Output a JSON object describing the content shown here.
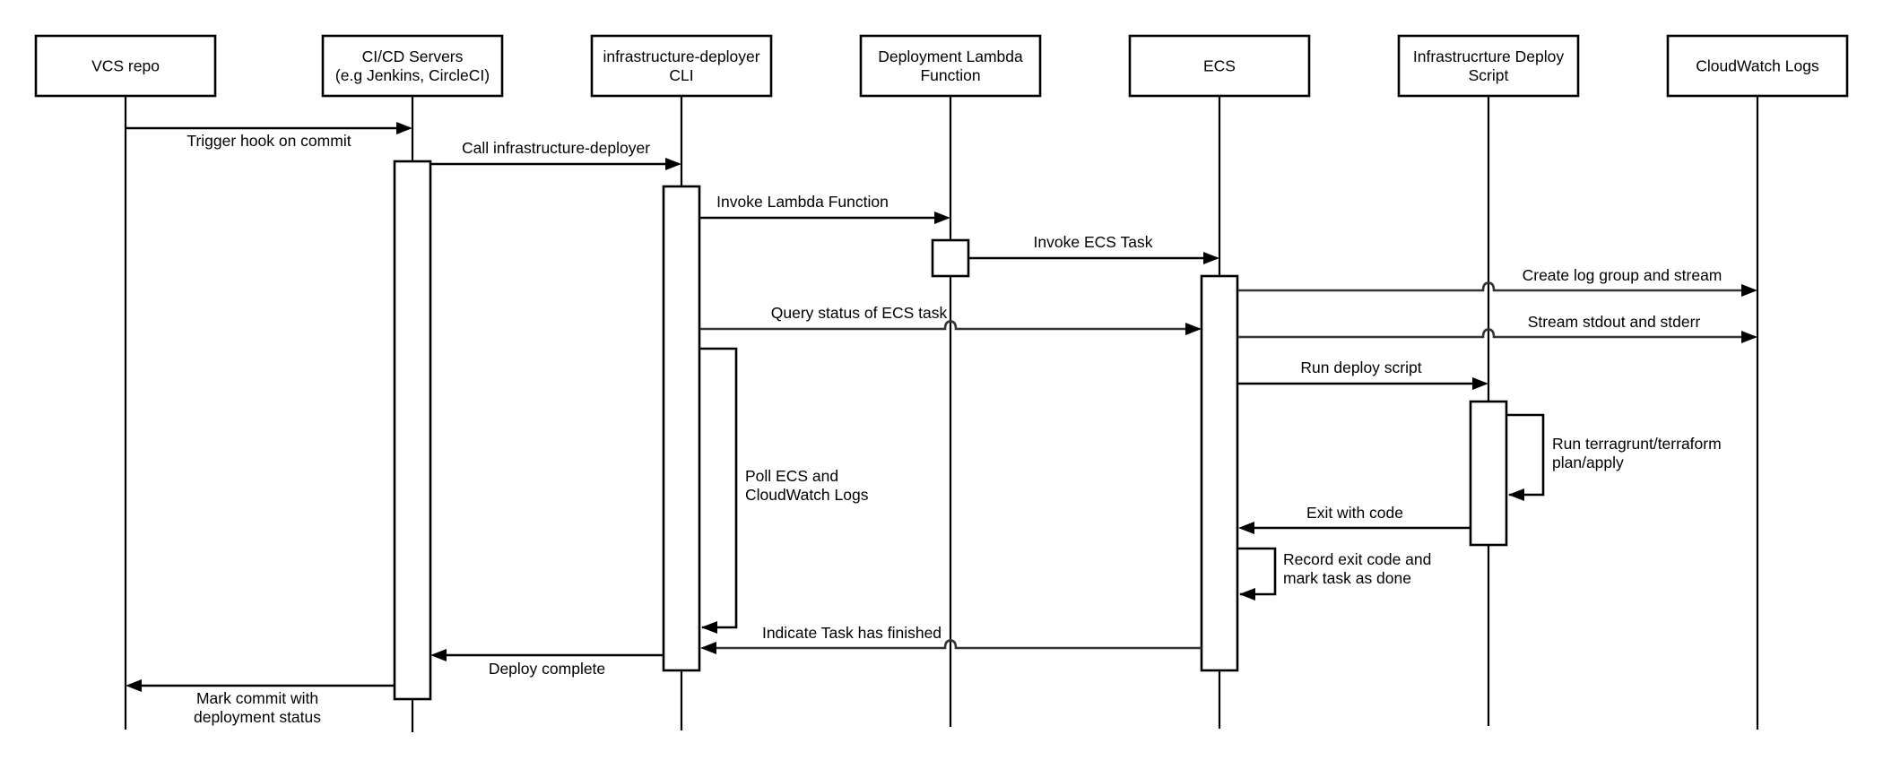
{
  "diagram": {
    "type": "sequence",
    "colors": {
      "line": "#000000",
      "background": "#ffffff"
    },
    "actors": [
      {
        "id": "vcs",
        "label_lines": [
          "VCS repo"
        ]
      },
      {
        "id": "cicd",
        "label_lines": [
          "CI/CD Servers",
          "(e.g Jenkins, CircleCI)"
        ]
      },
      {
        "id": "cli",
        "label_lines": [
          "infrastructure-deployer",
          "CLI"
        ]
      },
      {
        "id": "lambda",
        "label_lines": [
          "Deployment Lambda",
          "Function"
        ]
      },
      {
        "id": "ecs",
        "label_lines": [
          "ECS"
        ]
      },
      {
        "id": "script",
        "label_lines": [
          "Infrastrucrture Deploy",
          "Script"
        ]
      },
      {
        "id": "cwlogs",
        "label_lines": [
          "CloudWatch Logs"
        ]
      }
    ],
    "messages": [
      {
        "from": "vcs",
        "to": "cicd",
        "label_lines": [
          "Trigger hook on commit"
        ],
        "label_position": "below"
      },
      {
        "from": "cicd",
        "to": "cli",
        "label_lines": [
          "Call infrastructure-deployer"
        ],
        "label_position": "above"
      },
      {
        "from": "cli",
        "to": "lambda",
        "label_lines": [
          "Invoke Lambda Function"
        ],
        "label_position": "above"
      },
      {
        "from": "lambda",
        "to": "ecs",
        "label_lines": [
          "Invoke ECS Task"
        ],
        "label_position": "above"
      },
      {
        "from": "ecs",
        "to": "cwlogs",
        "label_lines": [
          "Create log group and stream"
        ],
        "label_position": "above"
      },
      {
        "from": "cli",
        "to": "ecs",
        "label_lines": [
          "Query status of ECS task"
        ],
        "label_position": "above"
      },
      {
        "from": "ecs",
        "to": "cwlogs",
        "label_lines": [
          "Stream stdout and stderr"
        ],
        "label_position": "above"
      },
      {
        "from": "cli",
        "to": "cli",
        "label_lines": [
          "Poll ECS and",
          "CloudWatch Logs"
        ],
        "self": true
      },
      {
        "from": "ecs",
        "to": "script",
        "label_lines": [
          "Run deploy script"
        ],
        "label_position": "above"
      },
      {
        "from": "script",
        "to": "script",
        "label_lines": [
          "Run terragrunt/terraform",
          "plan/apply"
        ],
        "self": true
      },
      {
        "from": "script",
        "to": "ecs",
        "label_lines": [
          "Exit with code"
        ],
        "label_position": "above"
      },
      {
        "from": "ecs",
        "to": "ecs",
        "label_lines": [
          "Record exit code and",
          "mark task as done"
        ],
        "self": true
      },
      {
        "from": "ecs",
        "to": "cli",
        "label_lines": [
          "Indicate Task has finished"
        ],
        "label_position": "above"
      },
      {
        "from": "cli",
        "to": "cicd",
        "label_lines": [
          "Deploy complete"
        ],
        "label_position": "below"
      },
      {
        "from": "cicd",
        "to": "vcs",
        "label_lines": [
          "Mark commit with",
          "deployment status"
        ],
        "label_position": "below"
      }
    ]
  }
}
